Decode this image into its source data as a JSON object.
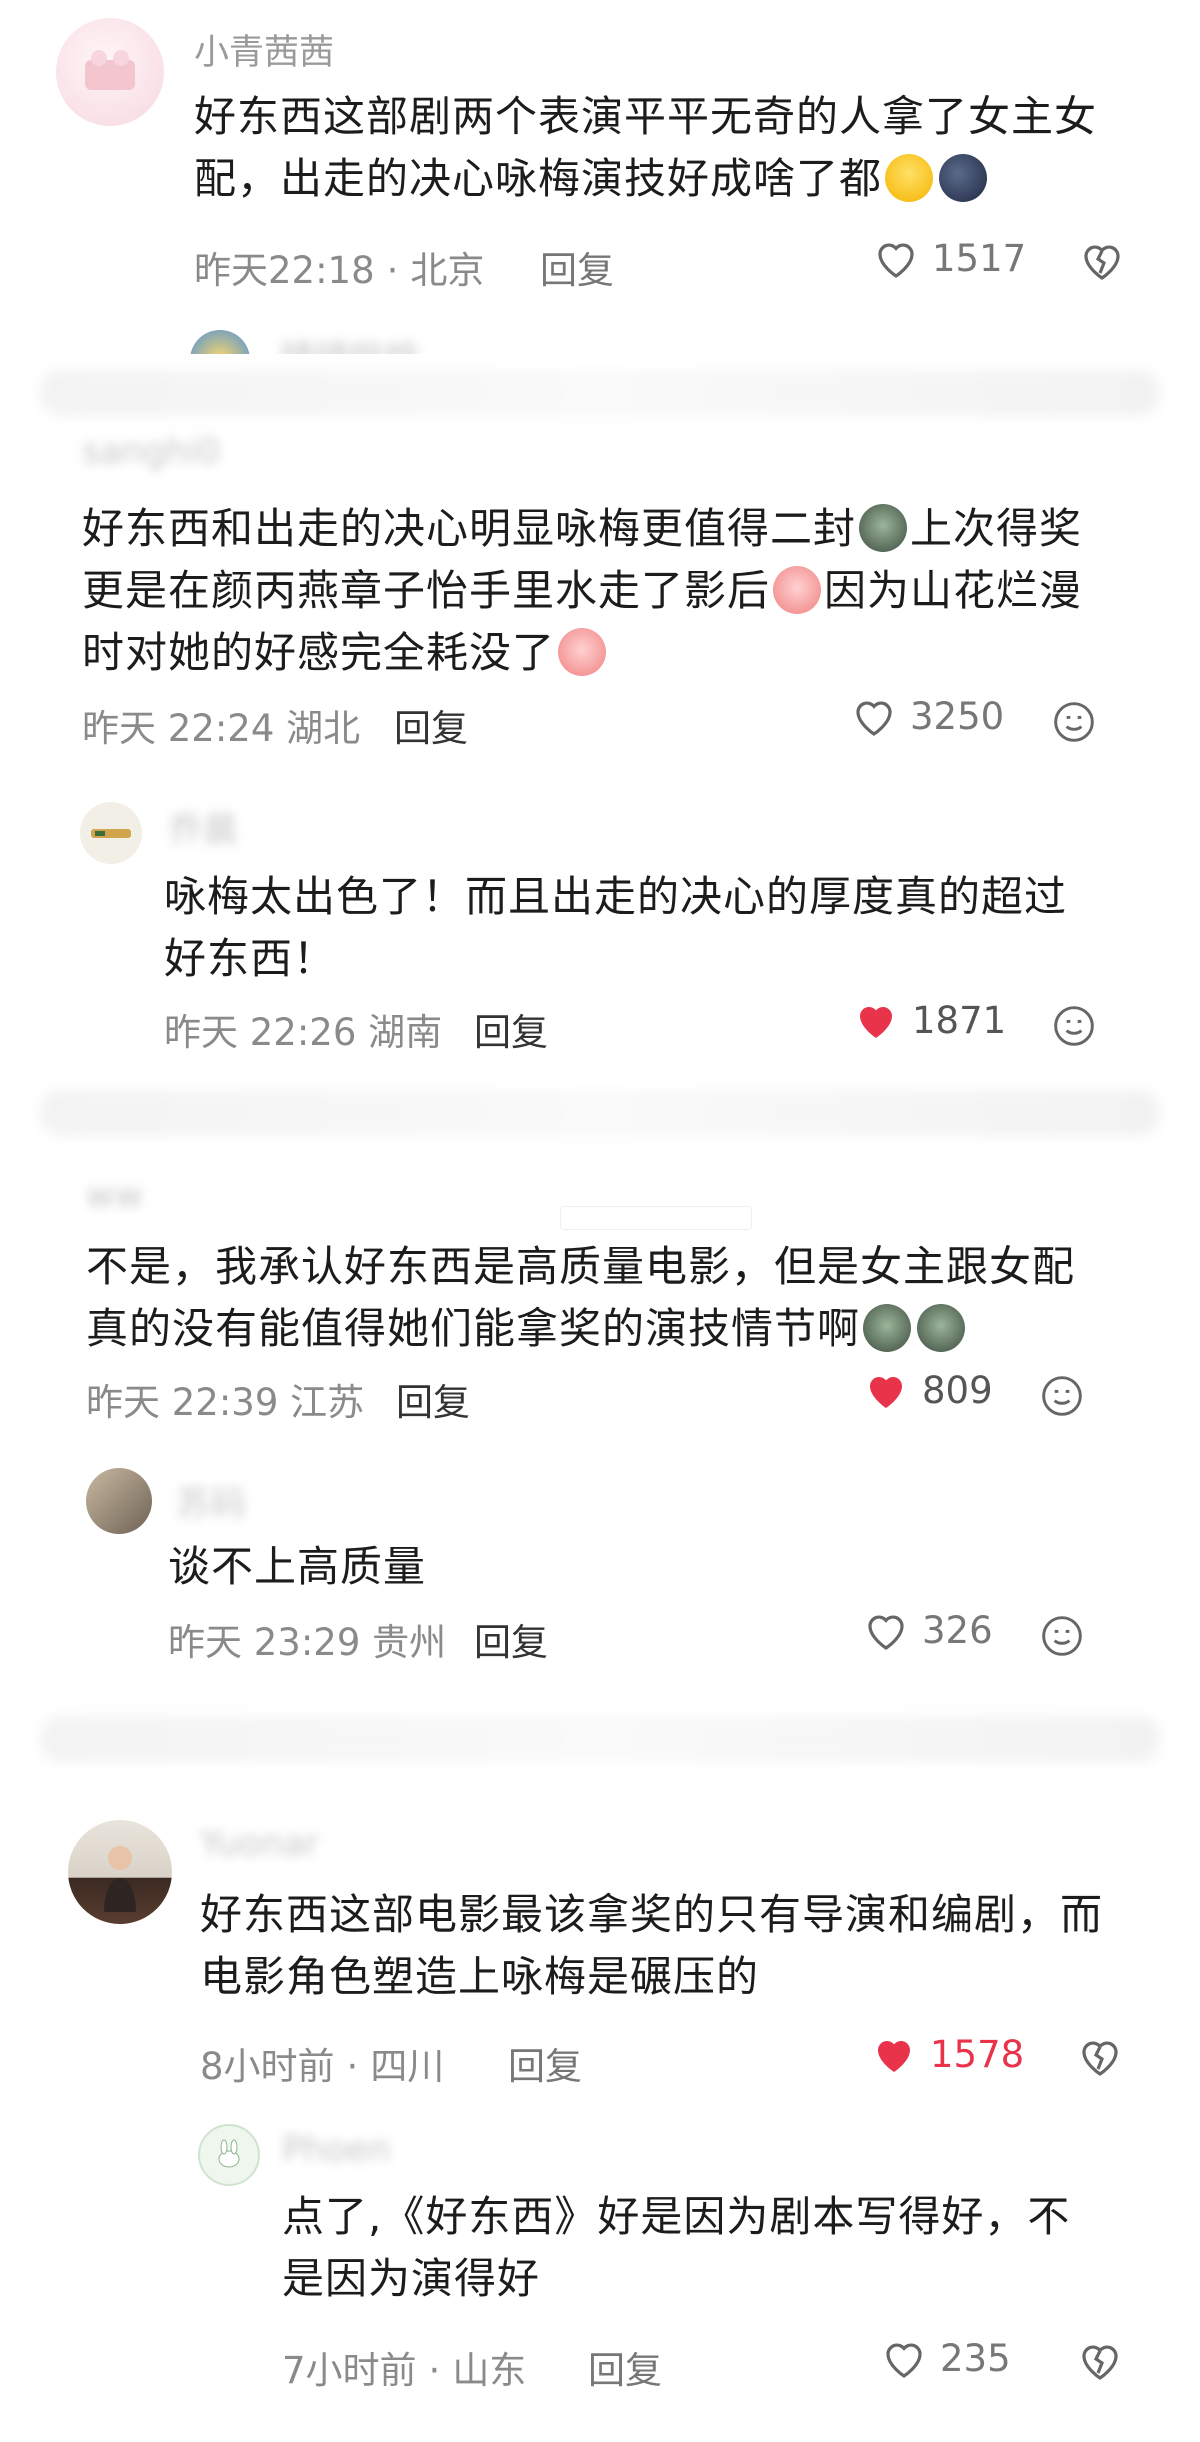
{
  "comments": [
    {
      "username": "小青茜茜",
      "text_parts": [
        "好东西这部剧两个表演平平无奇的人拿了女主女配，出走的决心咏梅演技好成啥了都"
      ],
      "emojis": [
        "grin-sweat-emoji",
        "dark-moon-emoji"
      ],
      "time": "昨天22:18",
      "sep": "·",
      "location": "北京",
      "reply": "回复",
      "likes": "1517",
      "liked": false,
      "side_icon": "broken-heart-icon"
    },
    {
      "username": "晴晴晗晗",
      "username_visible": "partial"
    },
    {
      "username": "sanghi0",
      "text_parts": [
        "好东西和出走的决心明显咏梅更值得二封",
        "上次得奖更是在颜丙燕章子怡手里水走了影后",
        "因为山花烂漫时对她的好感完全耗没了"
      ],
      "emojis": [
        "cat-emoji",
        "crying-emoji",
        "crying-emoji"
      ],
      "time": "昨天 22:24",
      "location": "湖北",
      "reply": "回复",
      "likes": "3250",
      "liked": false,
      "side_icon": "smiley-icon"
    },
    {
      "username": "乔晨",
      "text": "咏梅太出色了！而且出走的决心的厚度真的超过好东西！",
      "time": "昨天 22:26",
      "location": "湖南",
      "reply": "回复",
      "likes": "1871",
      "liked": true,
      "side_icon": "smiley-icon"
    },
    {
      "username": "ww",
      "text_parts": [
        "不是，我承认好东西是高质量电影，但是女主跟女配真的没有能值得她们能拿奖的演技情节啊"
      ],
      "emojis": [
        "cat-emoji",
        "cat-emoji"
      ],
      "time": "昨天 22:39",
      "location": "江苏",
      "reply": "回复",
      "likes": "809",
      "liked": true,
      "side_icon": "smiley-icon"
    },
    {
      "username": "苏码",
      "text": "谈不上高质量",
      "time": "昨天 23:29",
      "location": "贵州",
      "reply": "回复",
      "likes": "326",
      "liked": false,
      "side_icon": "smiley-icon"
    },
    {
      "username": "Yuonar",
      "text": "好东西这部电影最该拿奖的只有导演和编剧，而电影角色塑造上咏梅是碾压的",
      "time": "8小时前",
      "sep": "·",
      "location": "四川",
      "reply": "回复",
      "likes": "1578",
      "liked": true,
      "side_icon": "broken-heart-icon"
    },
    {
      "username": "Phoen",
      "text": "点了,《好东西》好是因为剧本写得好，不是因为演得好",
      "time": "7小时前",
      "sep": "·",
      "location": "山东",
      "reply": "回复",
      "likes": "235",
      "liked": false,
      "side_icon": "broken-heart-icon"
    }
  ],
  "colors": {
    "liked_red": "#e8334a",
    "meta_grey": "#8a8a8a",
    "text": "#1c1c1c"
  }
}
